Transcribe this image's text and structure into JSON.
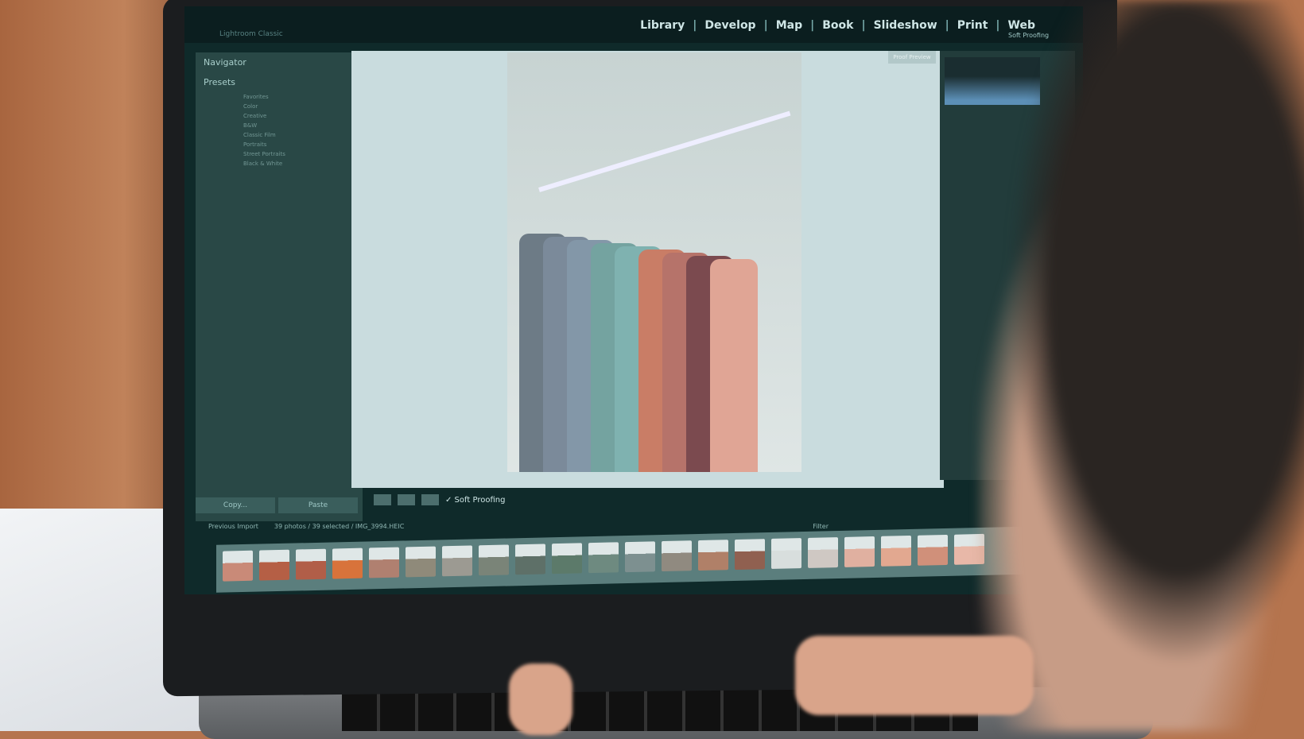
{
  "app": {
    "identity": "Lightroom Classic"
  },
  "modules": [
    "Library",
    "Develop",
    "Map",
    "Book",
    "Slideshow",
    "Print",
    "Web"
  ],
  "left_panel": {
    "navigator": "Navigator",
    "presets": "Presets",
    "preset_items": [
      "Favorites",
      "Color",
      "Creative",
      "B&W",
      "Classic Film",
      "Portraits",
      "Street Portraits",
      "Black & White"
    ],
    "copy": "Copy...",
    "paste": "Paste"
  },
  "canvas": {
    "proof_preview": "Proof Preview"
  },
  "toolbar": {
    "soft_proofing": "✓ Soft Proofing"
  },
  "right_panel": {
    "soft_proofing": "Soft Proofing"
  },
  "filmstrip": {
    "source": "Previous Import",
    "count": "39 photos / 39 selected / IMG_3994.HEIC",
    "filter": "Filter",
    "thumb_colors": [
      "#c98a78",
      "#b55f45",
      "#b15e48",
      "#d8733b",
      "#b08070",
      "#8f8a7a",
      "#9c9a92",
      "#7a8478",
      "#5e7068",
      "#5c7a6a",
      "#6e8a80",
      "#7d9090",
      "#908a80",
      "#b08068",
      "#906050",
      "#d8dedd",
      "#cfc8c3",
      "#e0b0a0",
      "#e2a890",
      "#d0907a",
      "#e8b8a8"
    ]
  },
  "shirt_colors": [
    "#6d7b86",
    "#7b8a9a",
    "#8397a8",
    "#74a3a0",
    "#7fb2b0",
    "#c97d66",
    "#b6736a",
    "#7b4a4f",
    "#e0a595"
  ]
}
